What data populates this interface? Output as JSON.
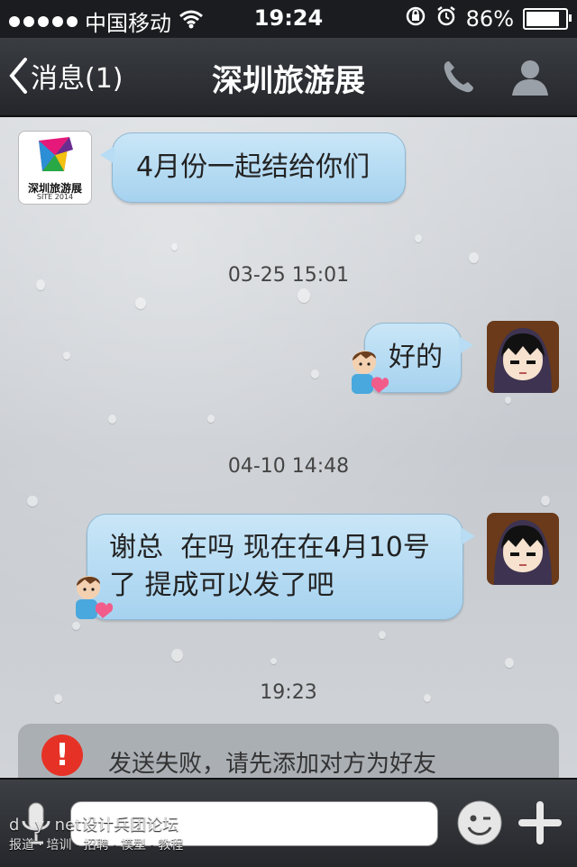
{
  "status_bar": {
    "carrier": "中国移动",
    "time": "19:24",
    "battery": "86%",
    "battery_level": 0.86,
    "icons": [
      "signal-dots-icon",
      "wifi-icon",
      "rotation-lock-icon",
      "alarm-icon",
      "battery-icon"
    ]
  },
  "nav": {
    "back_label": "消息(1)",
    "title": "深圳旅游展",
    "icons": [
      "phone-icon",
      "profile-icon"
    ]
  },
  "contact_avatar": {
    "line1": "深圳旅游展",
    "line2": "SITE 2014"
  },
  "messages": [
    {
      "side": "left",
      "text": "4月份一起结给你们"
    },
    {
      "side": "right",
      "text": "好的"
    },
    {
      "side": "right",
      "text_line1": "谢总  在吗 现在在4月10号",
      "text_line2": "了 提成可以发了吧"
    }
  ],
  "timestamps": [
    "03-25 15:01",
    "04-10 14:48",
    "19:23"
  ],
  "fail_notice": "发送失败，请先添加对方为好友",
  "input_bar": {
    "value": "",
    "icons": [
      "microphone-icon",
      "emoji-icon",
      "plus-icon"
    ]
  },
  "watermark": {
    "line1": "d   y  net设计兵团论坛",
    "line2": "报道 · 培训 · 招聘 · 模型 · 教程"
  },
  "colors": {
    "bubble": "#b7dcf3",
    "nav_bg": "#2d3034",
    "fail_icon": "#e63226"
  }
}
